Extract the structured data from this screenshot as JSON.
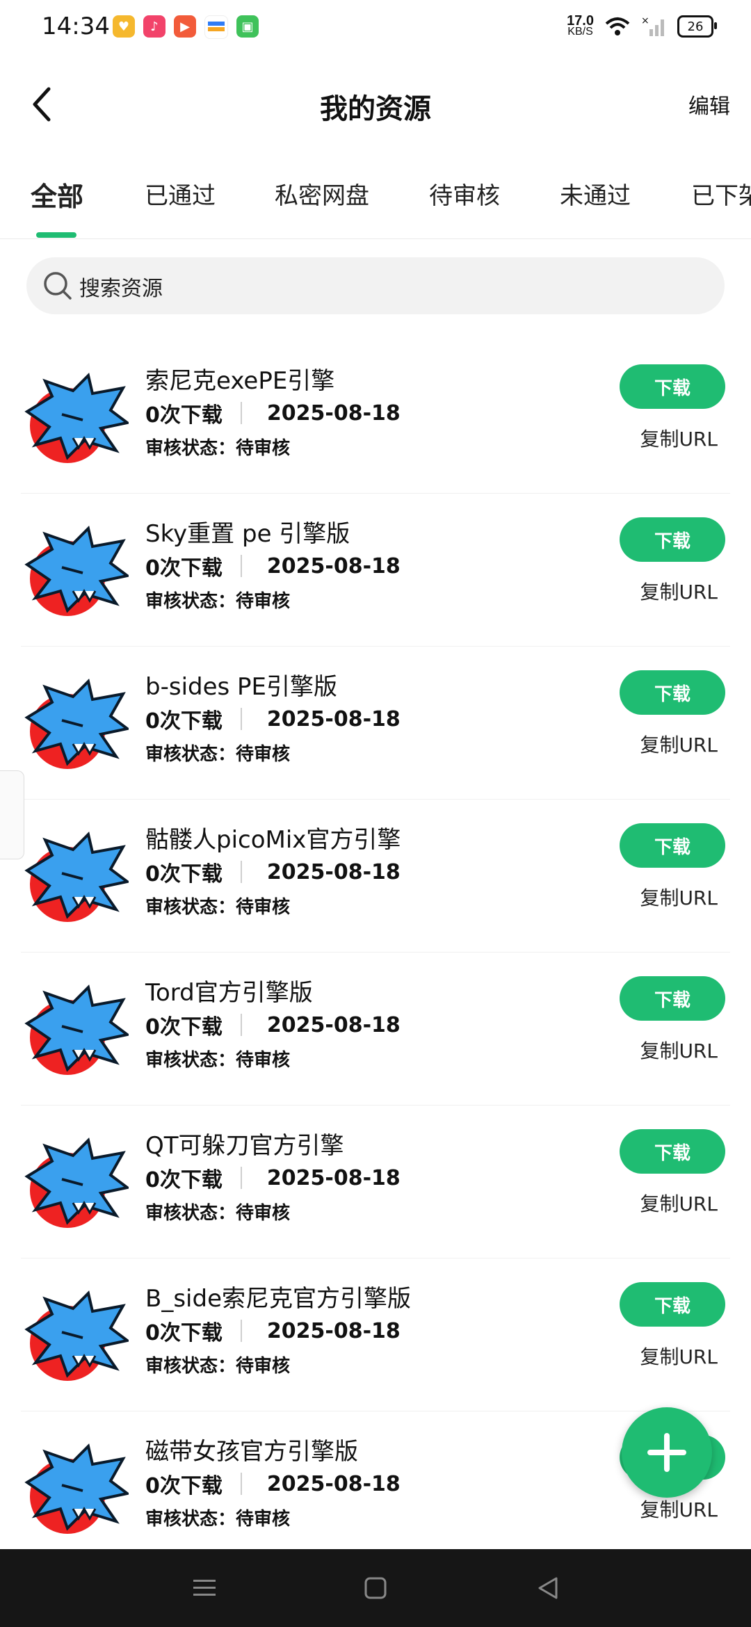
{
  "status_bar": {
    "time": "14:34",
    "net_speed_value": "17.0",
    "net_speed_unit": "KB/S",
    "battery": "26",
    "notification_icons": [
      "heart-app-icon",
      "music-app-icon",
      "video-app-icon",
      "wallet-app-icon",
      "android-app-icon"
    ]
  },
  "header": {
    "title": "我的资源",
    "edit_label": "编辑"
  },
  "tabs": [
    "全部",
    "已通过",
    "私密网盘",
    "待审核",
    "未通过",
    "已下架"
  ],
  "search": {
    "placeholder": "搜索资源"
  },
  "resources": [
    {
      "name": "索尼克exePE引擎",
      "downloads": "0次下载",
      "date": "2025-08-18",
      "status": "审核状态：待审核",
      "download_label": "下载",
      "copy_label": "复制URL"
    },
    {
      "name": "Sky重置  pe 引擎版",
      "downloads": "0次下载",
      "date": "2025-08-18",
      "status": "审核状态：待审核",
      "download_label": "下载",
      "copy_label": "复制URL"
    },
    {
      "name": "b-sides PE引擎版",
      "downloads": "0次下载",
      "date": "2025-08-18",
      "status": "审核状态：待审核",
      "download_label": "下载",
      "copy_label": "复制URL"
    },
    {
      "name": "骷髅人picoMix官方引擎",
      "downloads": "0次下载",
      "date": "2025-08-18",
      "status": "审核状态：待审核",
      "download_label": "下载",
      "copy_label": "复制URL"
    },
    {
      "name": "Tord官方引擎版",
      "downloads": "0次下载",
      "date": "2025-08-18",
      "status": "审核状态：待审核",
      "download_label": "下载",
      "copy_label": "复制URL"
    },
    {
      "name": "QT可躲刀官方引擎",
      "downloads": "0次下载",
      "date": "2025-08-18",
      "status": "审核状态：待审核",
      "download_label": "下载",
      "copy_label": "复制URL"
    },
    {
      "name": "B_side索尼克官方引擎版",
      "downloads": "0次下载",
      "date": "2025-08-18",
      "status": "审核状态：待审核",
      "download_label": "下载",
      "copy_label": "复制URL"
    },
    {
      "name": "磁带女孩官方引擎版",
      "downloads": "0次下载",
      "date": "2025-08-18",
      "status": "审核状态：待审核",
      "download_label": "下载",
      "copy_label": "复制URL"
    }
  ],
  "colors": {
    "accent": "#1fbc72",
    "navbar": "#161616",
    "search_bg": "#f2f2f2"
  },
  "fab": {
    "icon": "plus-icon"
  },
  "navbar": {
    "icons": [
      "menu-icon",
      "home-icon",
      "back-triangle-icon"
    ]
  }
}
